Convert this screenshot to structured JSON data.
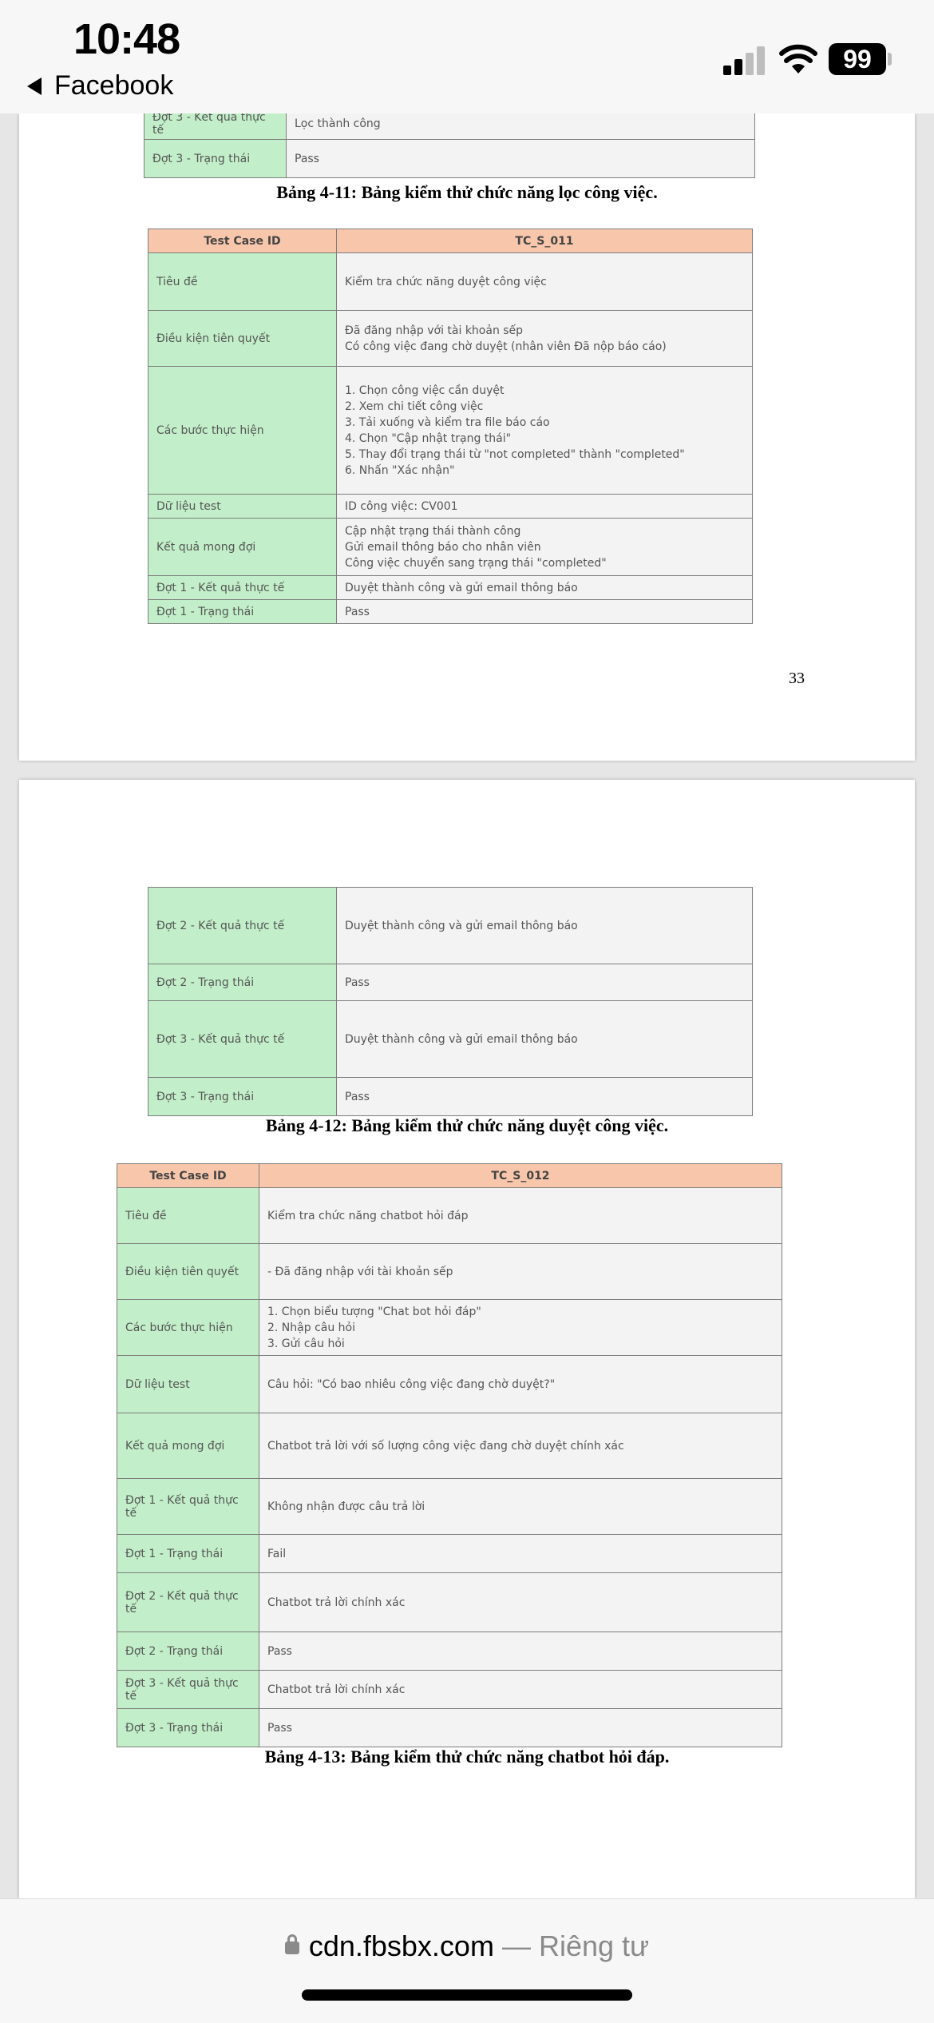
{
  "status_bar": {
    "time": "10:48",
    "back_label": "Facebook",
    "battery": "99",
    "icons": [
      "signal-icon",
      "wifi-icon",
      "battery-icon"
    ]
  },
  "page1": {
    "top_table_rows": [
      {
        "label": "Đợt 3 - Kết quả thực tế",
        "value": "Lọc thành công"
      },
      {
        "label": "Đợt 3 - Trạng thái",
        "value": "Pass"
      }
    ],
    "caption_1": "Bảng 4-11: Bảng kiểm thử chức năng lọc công việc.",
    "table_2": {
      "header": {
        "label": "Test Case ID",
        "value": "TC_S_011"
      },
      "rows": [
        {
          "label": "Tiêu đề",
          "value": "Kiểm tra chức năng duyệt công việc"
        },
        {
          "label": "Điều kiện tiên quyết",
          "value": "Đã đăng nhập với tài khoản sếp\nCó công việc đang chờ duyệt (nhân viên Đã nộp báo cáo)"
        },
        {
          "label": "Các bước thực hiện",
          "value": "1. Chọn công việc cần duyệt\n2. Xem chi tiết công việc\n3. Tải xuống và kiểm tra file báo cáo\n4. Chọn \"Cập nhật trạng thái\"\n5. Thay đổi trạng thái từ \"not completed\" thành \"completed\"\n6. Nhấn \"Xác nhận\""
        },
        {
          "label": "Dữ liệu test",
          "value": "ID công việc: CV001"
        },
        {
          "label": "Kết quả mong đợi",
          "value": "Cập nhật trạng thái thành công\nGửi email thông báo cho nhân viên\nCông việc chuyển sang trạng thái \"completed\""
        },
        {
          "label": "Đợt 1 - Kết quả thực tế",
          "value": "Duyệt thành công và gửi email thông báo"
        },
        {
          "label": "Đợt 1 - Trạng thái",
          "value": "Pass"
        }
      ]
    },
    "page_number": "33"
  },
  "page2": {
    "table_cont_rows": [
      {
        "label": "Đợt 2 - Kết quả thực tế",
        "value": "Duyệt thành công và gửi email thông báo"
      },
      {
        "label": "Đợt 2 - Trạng thái",
        "value": "Pass"
      },
      {
        "label": "Đợt 3 - Kết quả thực tế",
        "value": "Duyệt thành công và gửi email thông báo"
      },
      {
        "label": "Đợt 3 - Trạng thái",
        "value": "Pass"
      }
    ],
    "caption_2": "Bảng 4-12: Bảng kiểm thử chức năng duyệt công việc.",
    "table_3": {
      "header": {
        "label": "Test Case ID",
        "value": "TC_S_012"
      },
      "rows": [
        {
          "label": "Tiêu đề",
          "value": "Kiểm tra chức năng chatbot hỏi đáp"
        },
        {
          "label": "Điều kiện tiên quyết",
          "value": "- Đã đăng nhập với tài khoản sếp"
        },
        {
          "label": "Các bước thực hiện",
          "value": "1. Chọn biểu tượng \"Chat bot hỏi đáp\"\n2. Nhập câu hỏi\n3. Gửi câu hỏi"
        },
        {
          "label": "Dữ liệu test",
          "value": "Câu hỏi: \"Có bao nhiêu công việc đang chờ duyệt?\""
        },
        {
          "label": "Kết quả mong đợi",
          "value": "Chatbot trả lời với số lượng công việc đang chờ duyệt chính xác"
        },
        {
          "label": "Đợt 1 - Kết quả thực tế",
          "value": "Không nhận được câu trả lời"
        },
        {
          "label": "Đợt 1 - Trạng thái",
          "value": "Fail"
        },
        {
          "label": "Đợt 2 - Kết quả thực tế",
          "value": "Chatbot trả lời chính xác"
        },
        {
          "label": "Đợt 2 - Trạng thái",
          "value": "Pass"
        },
        {
          "label": "Đợt 3 - Kết quả thực tế",
          "value": "Chatbot trả lời chính xác"
        },
        {
          "label": "Đợt 3 - Trạng thái",
          "value": "Pass"
        }
      ]
    },
    "caption_3": "Bảng 4-13: Bảng kiểm thử chức năng chatbot hỏi đáp."
  },
  "address_bar": {
    "domain": "cdn.fbsbx.com",
    "suffix": "— Riêng tư"
  }
}
